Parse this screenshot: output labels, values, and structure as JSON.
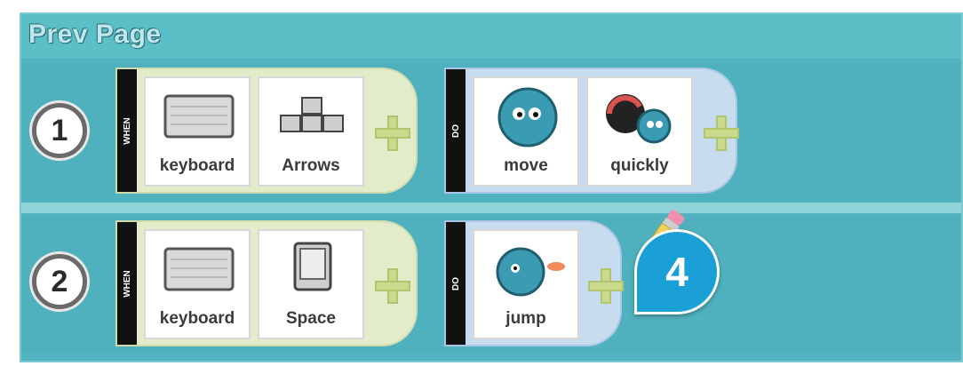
{
  "header": {
    "prev_page_label": "Prev Page"
  },
  "rows": [
    {
      "number": "1",
      "when_label": "WHEN",
      "when_cards": [
        {
          "label": "keyboard",
          "icon": "keyboard-icon"
        },
        {
          "label": "Arrows",
          "icon": "arrow-keys-icon"
        }
      ],
      "do_label": "DO",
      "do_cards": [
        {
          "label": "move",
          "icon": "move-character-icon"
        },
        {
          "label": "quickly",
          "icon": "speed-gauge-icon"
        }
      ]
    },
    {
      "number": "2",
      "when_label": "WHEN",
      "when_cards": [
        {
          "label": "keyboard",
          "icon": "keyboard-icon"
        },
        {
          "label": "Space",
          "icon": "space-key-icon"
        }
      ],
      "do_label": "DO",
      "do_cards": [
        {
          "label": "jump",
          "icon": "jump-character-icon"
        }
      ]
    }
  ],
  "callout": {
    "number": "4"
  },
  "colors": {
    "background": "#52b4c0",
    "when_block": "#e2eccb",
    "do_block": "#c7dcef",
    "callout": "#1aa0d6"
  }
}
